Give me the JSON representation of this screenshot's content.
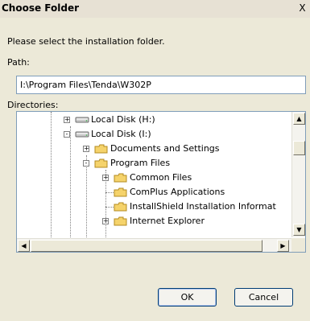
{
  "window": {
    "title": "Choose Folder",
    "close_label": "X"
  },
  "prompt": "Please select the installation folder.",
  "path": {
    "label": "Path:",
    "value": "I:\\Program Files\\Tenda\\W302P"
  },
  "directories": {
    "label": "Directories:",
    "items": [
      {
        "label": "Local Disk (H:)",
        "icon": "drive-icon",
        "expander": "+"
      },
      {
        "label": "Local Disk (I:)",
        "icon": "drive-icon",
        "expander": "-"
      },
      {
        "label": "Documents and Settings",
        "icon": "folder-icon",
        "expander": "+"
      },
      {
        "label": "Program Files",
        "icon": "folder-icon",
        "expander": "-"
      },
      {
        "label": "Common Files",
        "icon": "folder-icon",
        "expander": "+"
      },
      {
        "label": "ComPlus Applications",
        "icon": "folder-icon",
        "expander": ""
      },
      {
        "label": "InstallShield Installation Informat",
        "icon": "folder-icon",
        "expander": ""
      },
      {
        "label": "Internet Explorer",
        "icon": "folder-icon",
        "expander": "+"
      }
    ]
  },
  "buttons": {
    "ok": "OK",
    "cancel": "Cancel"
  },
  "colors": {
    "dialog_bg": "#ece9d8",
    "border": "#7f9db9",
    "folder_yellow": "#f5d36b"
  }
}
